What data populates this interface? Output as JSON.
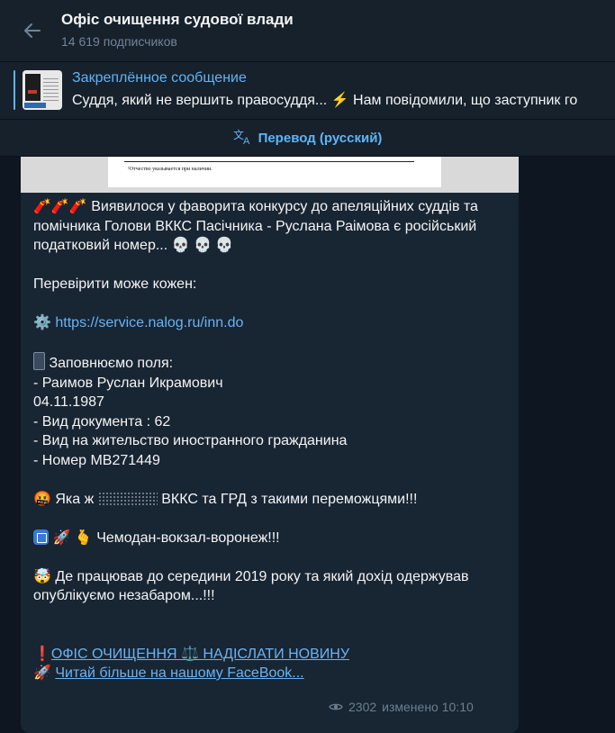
{
  "header": {
    "title": "Офіс очищення судової влади",
    "subscribers": "14 619 подписчиков"
  },
  "pinned": {
    "label": "Закреплённое сообщение",
    "text": "Суддя, який не вершить правосуддя... ⚡ Нам повідомили, що заступник го"
  },
  "translate": {
    "label": "Перевод (русский)",
    "icon": "translate-icon"
  },
  "document": {
    "footnote": "¹Отчество указывается при наличии."
  },
  "message": {
    "intro_emoji": "🧨🧨🧨",
    "intro_text": " Виявилося у фаворита конкурсу до апеляційних суддів та помічника Голови ВККС Пасічника - Руслана Раімова є російський податковий номер... ",
    "intro_skulls": "💀 💀 💀",
    "check_text": "Перевірити може кожен:",
    "link_emoji": "⚙️",
    "link_url": "https://service.nalog.ru/inn.do",
    "fill_title": " Заповнюємо поля:",
    "fields": [
      "- Раимов Руслан Икрамович",
      "04.11.1987",
      "- Вид документа : 62",
      "- Вид на жительство иностранного гражданина",
      "- Номер МВ271449"
    ],
    "angry_emoji": "🤬",
    "angry_prefix": " Яка ж ",
    "angry_suffix": " ВККС та ГРД з такими переможцями!!!",
    "travel_emojis": "🚀 🫰",
    "travel_text": " Чемодан-вокзал-воронеж!!!",
    "boom_emoji": "🤯",
    "boom_text": " Де працював до середини 2019 року та який дохід одержував опублікуємо незабаром...!!!",
    "footer_line1_emoji": "❗",
    "footer_line1_link": "ОФІС ОЧИЩЕННЯ ⚖️ НАДІСЛАТИ НОВИНУ",
    "footer_line2_emoji": "🚀",
    "footer_line2_link": "Читай більше на нашому FaceBook..."
  },
  "meta": {
    "views": "2302",
    "edited": "изменено 10:10"
  }
}
